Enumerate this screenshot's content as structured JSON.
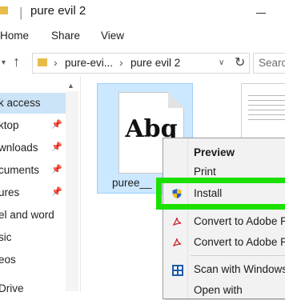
{
  "window": {
    "title": "pure evil 2"
  },
  "ribbon": {
    "tabs": [
      "Home",
      "Share",
      "View"
    ]
  },
  "address": {
    "crumbs": [
      "pure-evi...",
      "pure evil 2"
    ],
    "search_placeholder": "Searc"
  },
  "nav": {
    "items": [
      {
        "label": "k access",
        "pinned": false,
        "selected": true
      },
      {
        "label": "ktop",
        "pinned": true,
        "selected": false
      },
      {
        "label": "wnloads",
        "pinned": true,
        "selected": false
      },
      {
        "label": "cuments",
        "pinned": true,
        "selected": false
      },
      {
        "label": "ures",
        "pinned": true,
        "selected": false
      },
      {
        "label": "el and word",
        "pinned": false,
        "selected": false
      },
      {
        "label": "sic",
        "pinned": false,
        "selected": false
      },
      {
        "label": "eos",
        "pinned": false,
        "selected": false
      },
      {
        "label": "Drive",
        "pinned": false,
        "selected": false
      }
    ]
  },
  "file": {
    "name": "puree__",
    "glyph": "Abg"
  },
  "context_menu": {
    "items": [
      {
        "label": "Preview",
        "bold": true,
        "icon": ""
      },
      {
        "label": "Print",
        "bold": false,
        "icon": ""
      },
      {
        "label": "Install",
        "bold": false,
        "icon": "shield-icon"
      },
      {
        "label": "Convert to Adobe P",
        "bold": false,
        "icon": "pdf-icon"
      },
      {
        "label": "Convert to Adobe P",
        "bold": false,
        "icon": "pdf-icon"
      },
      {
        "label": "Scan with Windows",
        "bold": false,
        "icon": "defender-icon"
      },
      {
        "label": "Open with",
        "bold": false,
        "icon": ""
      }
    ]
  },
  "colors": {
    "highlight": "#1be000",
    "selection": "#cce8ff",
    "nav_selection": "#cce4f7"
  }
}
